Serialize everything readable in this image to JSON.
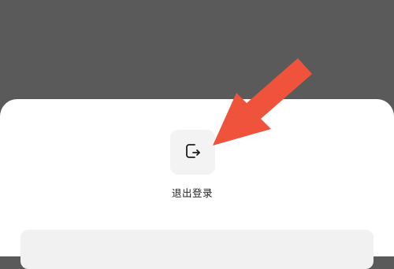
{
  "sheet": {
    "actions": [
      {
        "label": "退出登录",
        "icon": "logout-icon"
      }
    ]
  },
  "annotation": {
    "icon": "pointer-arrow",
    "color": "#f0533b"
  },
  "colors": {
    "backdrop": "#5a5a5a",
    "sheet": "#ffffff",
    "tile": "#f3f3f3",
    "text": "#222222"
  }
}
